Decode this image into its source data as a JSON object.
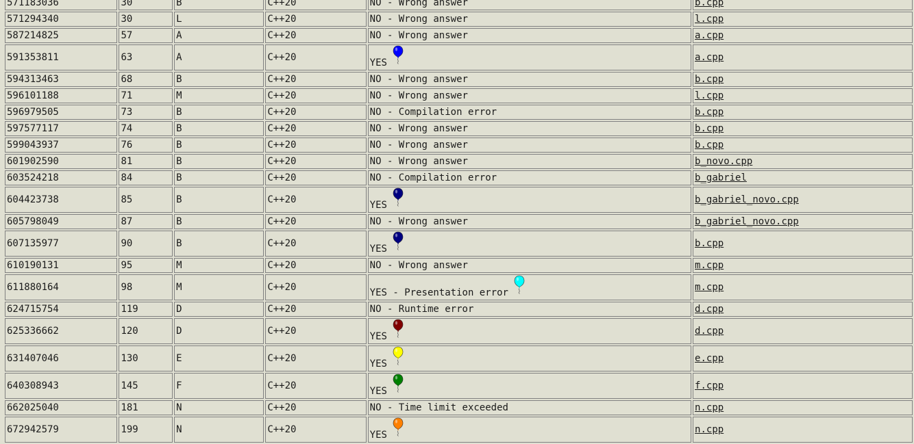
{
  "runs": [
    {
      "run": "571183036",
      "time": "30",
      "problem": "B",
      "language": "C++20",
      "answer": "NO - Wrong answer",
      "file": "b.cpp",
      "balloon": null
    },
    {
      "run": "571294340",
      "time": "30",
      "problem": "L",
      "language": "C++20",
      "answer": "NO - Wrong answer",
      "file": "l.cpp",
      "balloon": null
    },
    {
      "run": "587214825",
      "time": "57",
      "problem": "A",
      "language": "C++20",
      "answer": "NO - Wrong answer",
      "file": "a.cpp",
      "balloon": null
    },
    {
      "run": "591353811",
      "time": "63",
      "problem": "A",
      "language": "C++20",
      "answer": "YES",
      "file": "a.cpp",
      "balloon": "#0000ff"
    },
    {
      "run": "594313463",
      "time": "68",
      "problem": "B",
      "language": "C++20",
      "answer": "NO - Wrong answer",
      "file": "b.cpp",
      "balloon": null
    },
    {
      "run": "596101188",
      "time": "71",
      "problem": "M",
      "language": "C++20",
      "answer": "NO - Wrong answer",
      "file": "l.cpp",
      "balloon": null
    },
    {
      "run": "596979505",
      "time": "73",
      "problem": "B",
      "language": "C++20",
      "answer": "NO - Compilation error",
      "file": "b.cpp",
      "balloon": null
    },
    {
      "run": "597577117",
      "time": "74",
      "problem": "B",
      "language": "C++20",
      "answer": "NO - Wrong answer",
      "file": "b.cpp",
      "balloon": null
    },
    {
      "run": "599043937",
      "time": "76",
      "problem": "B",
      "language": "C++20",
      "answer": "NO - Wrong answer",
      "file": "b.cpp",
      "balloon": null
    },
    {
      "run": "601902590",
      "time": "81",
      "problem": "B",
      "language": "C++20",
      "answer": "NO - Wrong answer",
      "file": "b_novo.cpp",
      "balloon": null
    },
    {
      "run": "603524218",
      "time": "84",
      "problem": "B",
      "language": "C++20",
      "answer": "NO - Compilation error",
      "file": "b_gabriel",
      "balloon": null
    },
    {
      "run": "604423738",
      "time": "85",
      "problem": "B",
      "language": "C++20",
      "answer": "YES",
      "file": "b_gabriel_novo.cpp",
      "balloon": "#000080"
    },
    {
      "run": "605798049",
      "time": "87",
      "problem": "B",
      "language": "C++20",
      "answer": "NO - Wrong answer",
      "file": "b_gabriel_novo.cpp",
      "balloon": null
    },
    {
      "run": "607135977",
      "time": "90",
      "problem": "B",
      "language": "C++20",
      "answer": "YES",
      "file": "b.cpp",
      "balloon": "#000080"
    },
    {
      "run": "610190131",
      "time": "95",
      "problem": "M",
      "language": "C++20",
      "answer": "NO - Wrong answer",
      "file": "m.cpp",
      "balloon": null
    },
    {
      "run": "611880164",
      "time": "98",
      "problem": "M",
      "language": "C++20",
      "answer": "YES - Presentation error",
      "file": "m.cpp",
      "balloon": "#00ffff"
    },
    {
      "run": "624715754",
      "time": "119",
      "problem": "D",
      "language": "C++20",
      "answer": "NO - Runtime error",
      "file": "d.cpp",
      "balloon": null
    },
    {
      "run": "625336662",
      "time": "120",
      "problem": "D",
      "language": "C++20",
      "answer": "YES",
      "file": "d.cpp",
      "balloon": "#800000"
    },
    {
      "run": "631407046",
      "time": "130",
      "problem": "E",
      "language": "C++20",
      "answer": "YES",
      "file": "e.cpp",
      "balloon": "#ffff00"
    },
    {
      "run": "640308943",
      "time": "145",
      "problem": "F",
      "language": "C++20",
      "answer": "YES",
      "file": "f.cpp",
      "balloon": "#008000"
    },
    {
      "run": "662025040",
      "time": "181",
      "problem": "N",
      "language": "C++20",
      "answer": "NO - Time limit exceeded",
      "file": "n.cpp",
      "balloon": null
    },
    {
      "run": "672942579",
      "time": "199",
      "problem": "N",
      "language": "C++20",
      "answer": "YES",
      "file": "n.cpp",
      "balloon": "#ff8000"
    }
  ]
}
